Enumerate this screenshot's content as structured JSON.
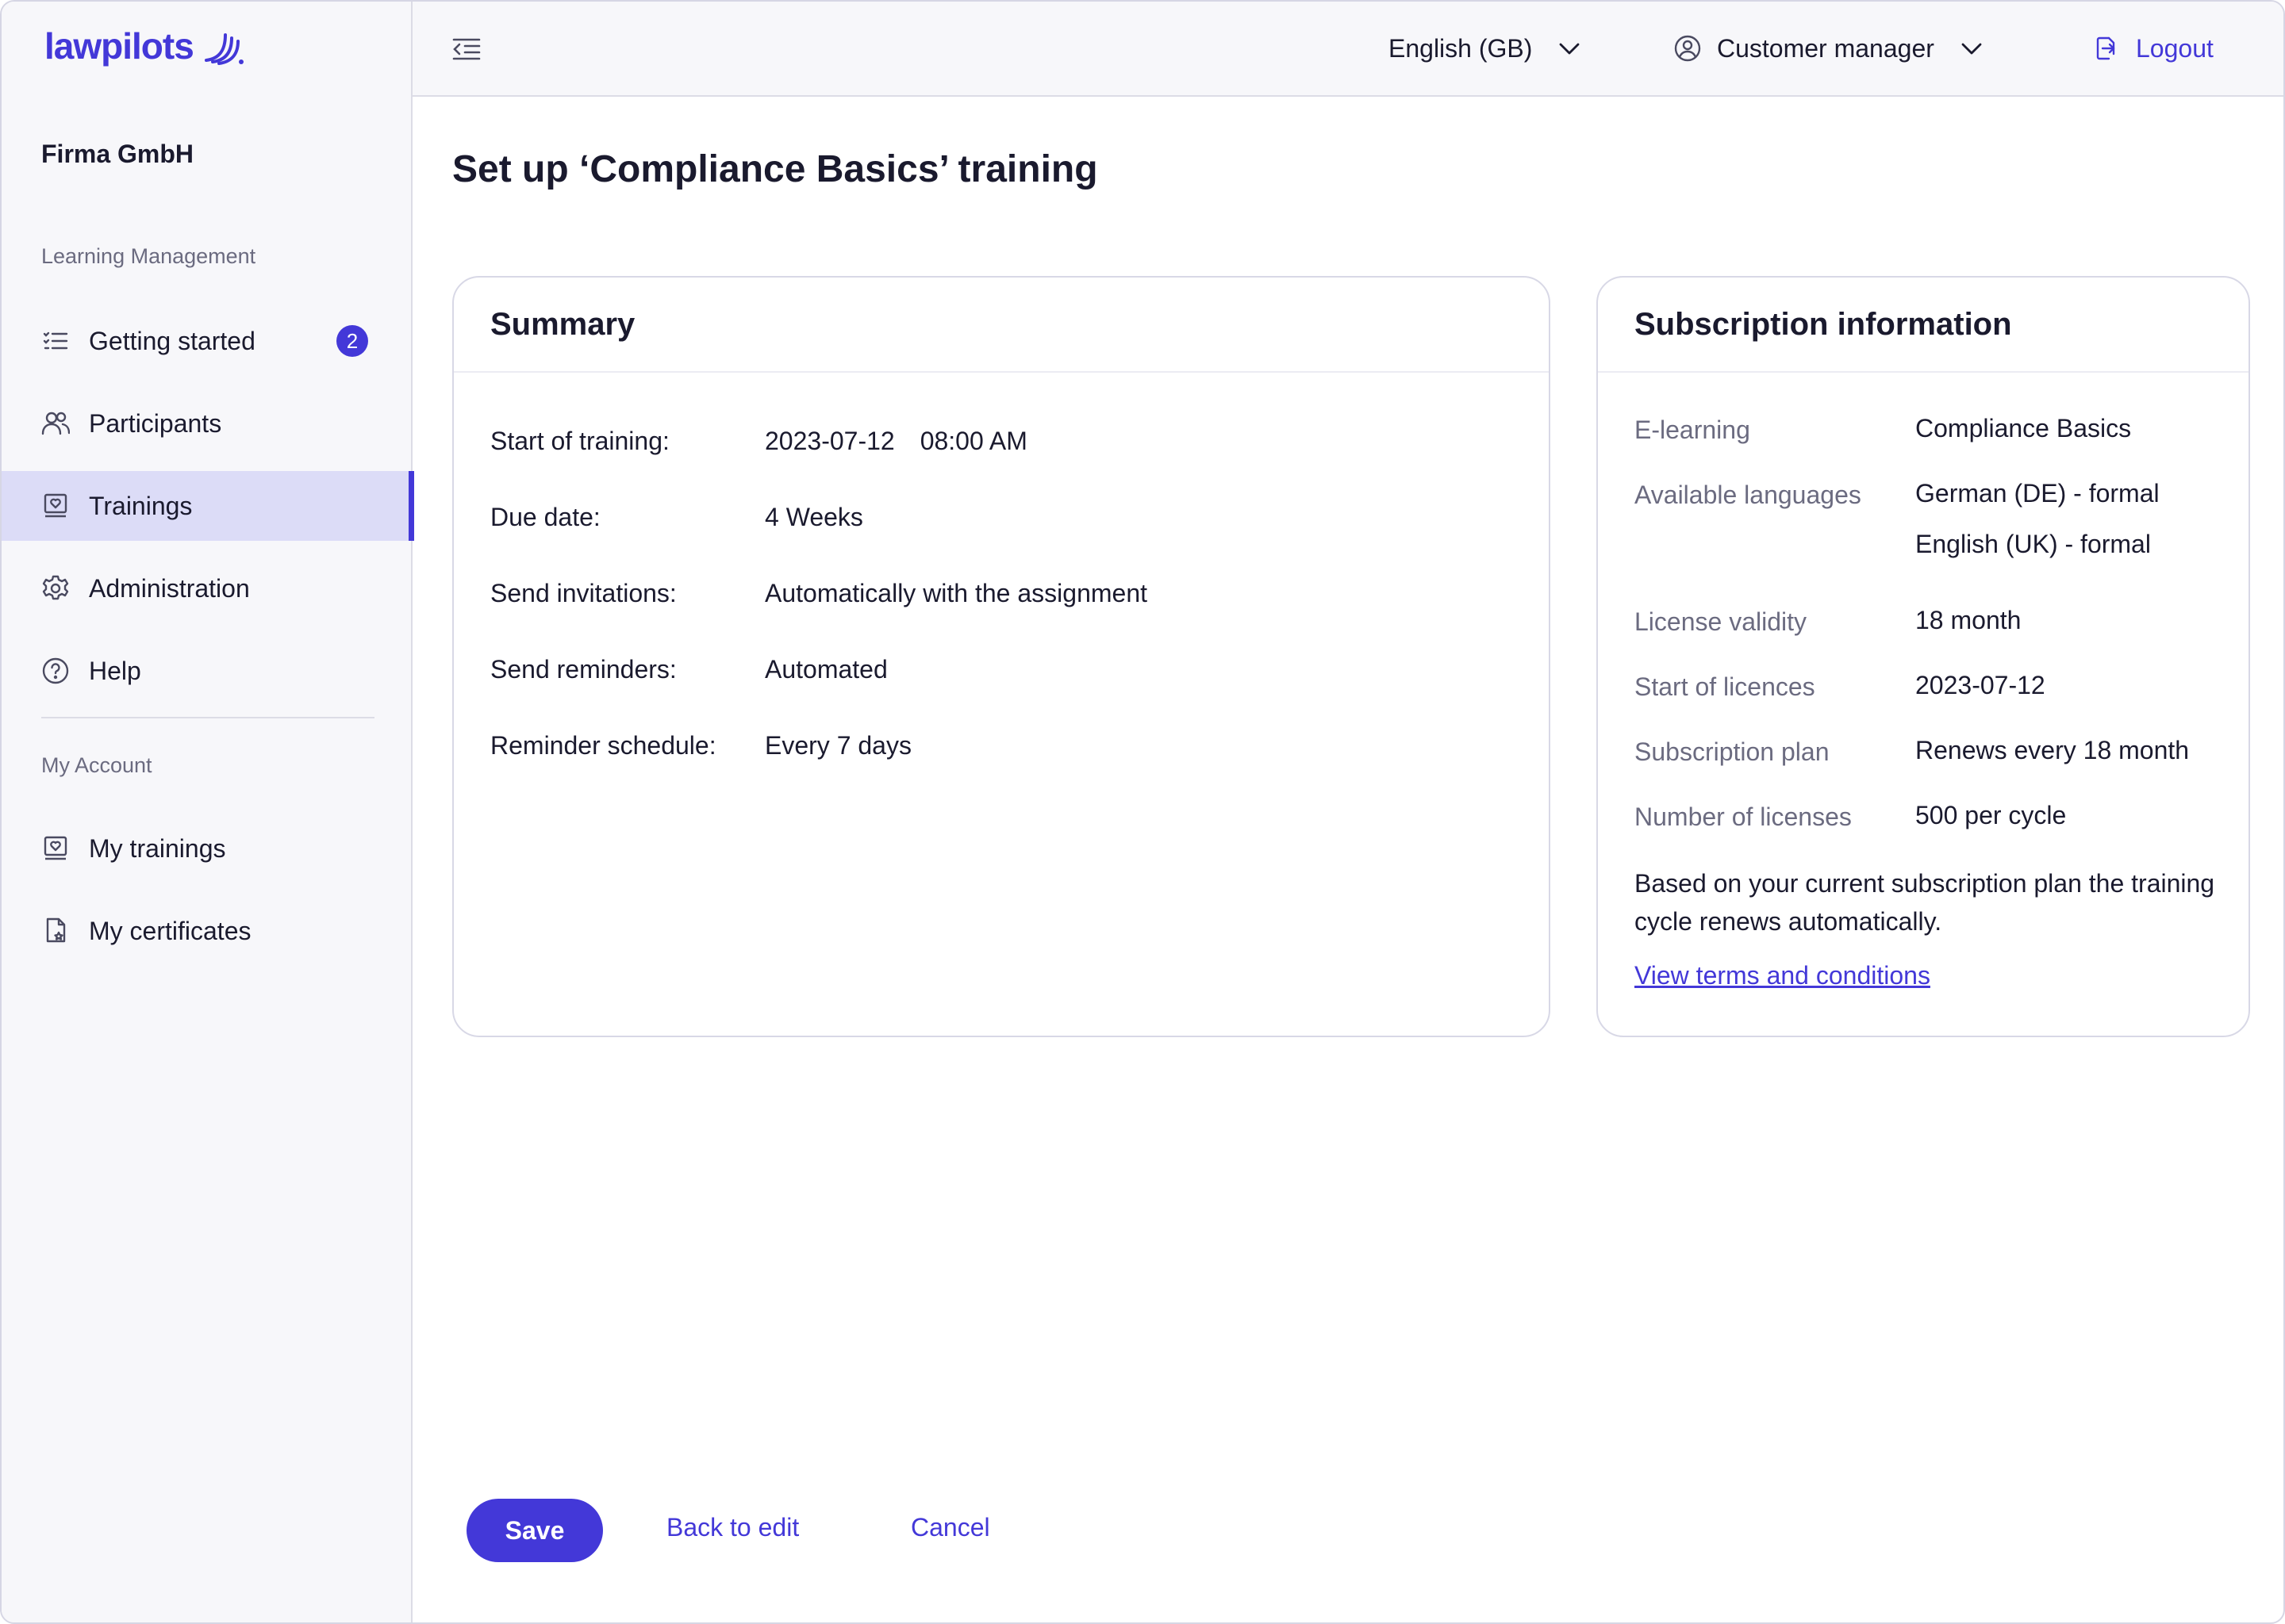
{
  "brand": {
    "name": "lawpilots",
    "accent": "#4338d8"
  },
  "sidebar": {
    "company": "Firma GmbH",
    "sections": [
      {
        "label": "Learning Management",
        "items": [
          {
            "label": "Getting started",
            "icon": "checklist-icon",
            "badge": "2"
          },
          {
            "label": "Participants",
            "icon": "users-icon"
          },
          {
            "label": "Trainings",
            "icon": "training-icon",
            "active": true
          },
          {
            "label": "Administration",
            "icon": "gear-icon"
          },
          {
            "label": "Help",
            "icon": "help-icon"
          }
        ]
      },
      {
        "label": "My Account",
        "items": [
          {
            "label": "My trainings",
            "icon": "training-icon"
          },
          {
            "label": "My certificates",
            "icon": "certificate-icon"
          }
        ]
      }
    ]
  },
  "header": {
    "language": "English (GB)",
    "role": "Customer manager",
    "logout": "Logout"
  },
  "page": {
    "title": "Set up ‘Compliance Basics’ training"
  },
  "summary": {
    "title": "Summary",
    "rows": [
      {
        "label": "Start of training:",
        "date": "2023-07-12",
        "time": "08:00 AM"
      },
      {
        "label": "Due date:",
        "value": "4 Weeks"
      },
      {
        "label": "Send invitations:",
        "value": "Automatically with the assignment"
      },
      {
        "label": "Send reminders:",
        "value": "Automated"
      },
      {
        "label": "Reminder schedule:",
        "value": "Every 7 days"
      }
    ]
  },
  "subscription": {
    "title": "Subscription information",
    "rows": [
      {
        "label": "E-learning",
        "value": "Compliance Basics"
      },
      {
        "label": "Available languages",
        "values": [
          "German (DE) - formal",
          "English (UK) - formal"
        ]
      },
      {
        "label": "License validity",
        "value": "18 month"
      },
      {
        "label": "Start of licences",
        "value": "2023-07-12"
      },
      {
        "label": "Subscription plan",
        "value": "Renews every 18 month"
      },
      {
        "label": "Number of licenses",
        "value": "500 per cycle"
      }
    ],
    "note": "Based on your current subscription plan the training cycle renews automatically.",
    "terms_link": "View terms and conditions"
  },
  "actions": {
    "save": "Save",
    "back": "Back to edit",
    "cancel": "Cancel"
  }
}
